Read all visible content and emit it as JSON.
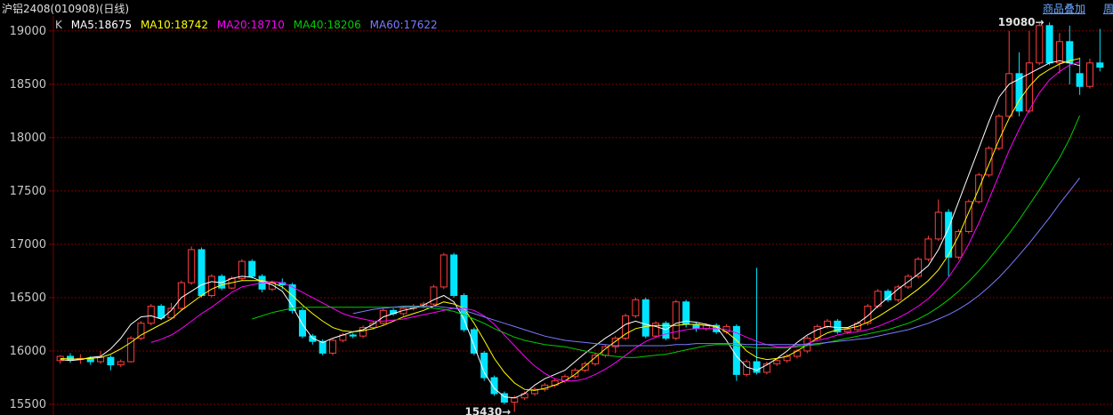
{
  "header": {
    "title": "沪铝2408(010908)(日线)",
    "overlay_link": "商品叠加",
    "period_link": "周"
  },
  "legend": {
    "k_label": "K",
    "ma5": "MA5:18675",
    "ma10": "MA10:18742",
    "ma20": "MA20:18710",
    "ma40": "MA40:18206",
    "ma60": "MA60:17622"
  },
  "colors": {
    "background": "#000000",
    "up": "#ff3d3d",
    "down": "#00e5ff",
    "grid": "#7a0000",
    "axis_text": "#c8c8c8",
    "ma5": "#ffffff",
    "ma10": "#ffff00",
    "ma20": "#ff00ff",
    "ma40": "#00cc00",
    "ma60": "#7a7aff"
  },
  "chart_data": {
    "type": "candlestick",
    "ylim": [
      15400,
      19140
    ],
    "yticks": [
      15500,
      16000,
      16500,
      17000,
      17500,
      18000,
      18500,
      19000
    ],
    "grid": true,
    "annotations": {
      "high_label": "19080",
      "high_value": 19080,
      "low_label": "15430",
      "low_value": 15430
    },
    "series": [
      {
        "name": "MA5",
        "values": [
          15920,
          15910,
          15920,
          15940,
          15950,
          16020,
          16120,
          16250,
          16320,
          16330,
          16300,
          16380,
          16500,
          16560,
          16620,
          16650,
          16640,
          16680,
          16700,
          16690,
          16650,
          16620,
          16560,
          16420,
          16250,
          16120,
          16080,
          16120,
          16150,
          16180,
          16200,
          16250,
          16320,
          16350,
          16380,
          16400,
          16430,
          16480,
          16520,
          16460,
          16300,
          16050,
          15800,
          15650,
          15570,
          15560,
          15600,
          15680,
          15740,
          15780,
          15820,
          15900,
          15980,
          16050,
          16120,
          16180,
          16250,
          16280,
          16250,
          16230,
          16200,
          16260,
          16280,
          16270,
          16250,
          16230,
          16100,
          15950,
          15850,
          15820,
          15870,
          15930,
          16000,
          16080,
          16150,
          16200,
          16230,
          16220,
          16220,
          16260,
          16330,
          16420,
          16500,
          16580,
          16650,
          16720,
          16800,
          16950,
          17150,
          17400,
          17650,
          17900,
          18150,
          18380,
          18500,
          18550,
          18600,
          18650,
          18700,
          18720,
          18700,
          18675
        ]
      },
      {
        "name": "MA10",
        "values": [
          15930,
          15925,
          15925,
          15930,
          15940,
          15970,
          16020,
          16080,
          16150,
          16200,
          16250,
          16300,
          16380,
          16450,
          16520,
          16580,
          16620,
          16640,
          16660,
          16660,
          16660,
          16640,
          16600,
          16520,
          16430,
          16350,
          16280,
          16220,
          16190,
          16180,
          16190,
          16210,
          16240,
          16280,
          16320,
          16350,
          16380,
          16420,
          16460,
          16440,
          16400,
          16260,
          16100,
          15930,
          15800,
          15700,
          15640,
          15630,
          15650,
          15680,
          15720,
          15780,
          15860,
          15940,
          16020,
          16090,
          16160,
          16210,
          16230,
          16240,
          16240,
          16240,
          16250,
          16250,
          16240,
          16230,
          16180,
          16100,
          16000,
          15940,
          15920,
          15930,
          15950,
          16000,
          16060,
          16120,
          16170,
          16200,
          16210,
          16230,
          16270,
          16320,
          16380,
          16440,
          16510,
          16580,
          16660,
          16760,
          16900,
          17080,
          17300,
          17520,
          17750,
          17980,
          18180,
          18350,
          18480,
          18580,
          18640,
          18690,
          18720,
          18742
        ]
      },
      {
        "name": "MA20",
        "values": [
          null,
          null,
          null,
          null,
          null,
          null,
          null,
          null,
          null,
          16080,
          16110,
          16150,
          16210,
          16280,
          16350,
          16410,
          16480,
          16550,
          16600,
          16620,
          16640,
          16650,
          16640,
          16600,
          16550,
          16500,
          16450,
          16400,
          16350,
          16320,
          16300,
          16280,
          16280,
          16290,
          16300,
          16320,
          16340,
          16360,
          16380,
          16400,
          16400,
          16380,
          16330,
          16250,
          16150,
          16050,
          15950,
          15860,
          15790,
          15740,
          15720,
          15720,
          15740,
          15780,
          15830,
          15890,
          15960,
          16030,
          16090,
          16130,
          16160,
          16180,
          16200,
          16210,
          16210,
          16210,
          16200,
          16170,
          16130,
          16090,
          16060,
          16040,
          16040,
          16050,
          16070,
          16100,
          16120,
          16150,
          16170,
          16180,
          16200,
          16230,
          16270,
          16310,
          16360,
          16420,
          16490,
          16580,
          16690,
          16830,
          17000,
          17200,
          17420,
          17650,
          17880,
          18080,
          18260,
          18420,
          18540,
          18620,
          18680,
          18710
        ]
      },
      {
        "name": "MA40",
        "values": [
          null,
          null,
          null,
          null,
          null,
          null,
          null,
          null,
          null,
          null,
          null,
          null,
          null,
          null,
          null,
          null,
          null,
          null,
          null,
          16300,
          16330,
          16360,
          16380,
          16400,
          16410,
          16410,
          16410,
          16410,
          16410,
          16410,
          16410,
          16410,
          16410,
          16410,
          16410,
          16410,
          16410,
          16400,
          16390,
          16370,
          16340,
          16300,
          16260,
          16210,
          16170,
          16130,
          16100,
          16080,
          16060,
          16050,
          16040,
          16020,
          16000,
          15980,
          15960,
          15950,
          15940,
          15940,
          15950,
          15960,
          15970,
          15990,
          16010,
          16030,
          16050,
          16060,
          16060,
          16050,
          16040,
          16030,
          16030,
          16030,
          16030,
          16040,
          16050,
          16060,
          16080,
          16100,
          16120,
          16140,
          16160,
          16180,
          16200,
          16230,
          16260,
          16300,
          16350,
          16410,
          16480,
          16560,
          16650,
          16750,
          16860,
          16980,
          17100,
          17230,
          17370,
          17510,
          17660,
          17810,
          17990,
          18206
        ]
      },
      {
        "name": "MA60",
        "values": [
          null,
          null,
          null,
          null,
          null,
          null,
          null,
          null,
          null,
          null,
          null,
          null,
          null,
          null,
          null,
          null,
          null,
          null,
          null,
          null,
          null,
          null,
          null,
          null,
          null,
          null,
          null,
          null,
          null,
          16350,
          16370,
          16390,
          16400,
          16410,
          16420,
          16420,
          16420,
          16420,
          16410,
          16400,
          16380,
          16350,
          16320,
          16290,
          16260,
          16230,
          16200,
          16170,
          16140,
          16120,
          16100,
          16090,
          16080,
          16070,
          16060,
          16050,
          16050,
          16050,
          16050,
          16050,
          16050,
          16060,
          16060,
          16070,
          16070,
          16070,
          16070,
          16070,
          16060,
          16060,
          16060,
          16060,
          16060,
          16060,
          16060,
          16070,
          16080,
          16090,
          16100,
          16110,
          16120,
          16140,
          16160,
          16180,
          16200,
          16230,
          16260,
          16300,
          16340,
          16390,
          16450,
          16520,
          16600,
          16690,
          16790,
          16900,
          17010,
          17130,
          17250,
          17380,
          17500,
          17622
        ]
      }
    ],
    "candles": [
      [
        15910,
        15950,
        15880,
        15960
      ],
      [
        15950,
        15920,
        15890,
        15980
      ],
      [
        15920,
        15930,
        15880,
        15970
      ],
      [
        15930,
        15900,
        15870,
        15950
      ],
      [
        15900,
        15940,
        15880,
        16000
      ],
      [
        15940,
        15870,
        15820,
        15960
      ],
      [
        15870,
        15900,
        15850,
        15920
      ],
      [
        15900,
        16120,
        15890,
        16140
      ],
      [
        16120,
        16260,
        16100,
        16280
      ],
      [
        16260,
        16420,
        16240,
        16440
      ],
      [
        16420,
        16310,
        16290,
        16440
      ],
      [
        16310,
        16400,
        16300,
        16450
      ],
      [
        16400,
        16640,
        16380,
        16660
      ],
      [
        16640,
        16950,
        16620,
        16980
      ],
      [
        16950,
        16520,
        16500,
        16970
      ],
      [
        16520,
        16700,
        16500,
        16720
      ],
      [
        16700,
        16590,
        16570,
        16720
      ],
      [
        16590,
        16680,
        16580,
        16700
      ],
      [
        16680,
        16840,
        16660,
        16860
      ],
      [
        16840,
        16700,
        16680,
        16860
      ],
      [
        16700,
        16580,
        16550,
        16720
      ],
      [
        16580,
        16640,
        16560,
        16660
      ],
      [
        16640,
        16620,
        16580,
        16680
      ],
      [
        16620,
        16380,
        16350,
        16640
      ],
      [
        16380,
        16140,
        16120,
        16400
      ],
      [
        16140,
        16090,
        16060,
        16160
      ],
      [
        16090,
        15980,
        15960,
        16110
      ],
      [
        15980,
        16100,
        15960,
        16120
      ],
      [
        16100,
        16150,
        16080,
        16170
      ],
      [
        16150,
        16140,
        16120,
        16170
      ],
      [
        16140,
        16220,
        16120,
        16240
      ],
      [
        16220,
        16260,
        16200,
        16280
      ],
      [
        16260,
        16380,
        16240,
        16400
      ],
      [
        16380,
        16350,
        16330,
        16400
      ],
      [
        16350,
        16400,
        16330,
        16420
      ],
      [
        16400,
        16420,
        16380,
        16440
      ],
      [
        16420,
        16440,
        16400,
        16460
      ],
      [
        16440,
        16600,
        16420,
        16620
      ],
      [
        16600,
        16900,
        16580,
        16920
      ],
      [
        16900,
        16520,
        16500,
        16920
      ],
      [
        16520,
        16200,
        16180,
        16540
      ],
      [
        16200,
        15980,
        15960,
        16220
      ],
      [
        15980,
        15750,
        15720,
        16000
      ],
      [
        15750,
        15600,
        15580,
        15770
      ],
      [
        15600,
        15520,
        15500,
        15620
      ],
      [
        15520,
        15560,
        15430,
        15580
      ],
      [
        15560,
        15600,
        15540,
        15620
      ],
      [
        15600,
        15640,
        15580,
        15660
      ],
      [
        15640,
        15680,
        15620,
        15700
      ],
      [
        15680,
        15720,
        15660,
        15740
      ],
      [
        15720,
        15760,
        15700,
        15780
      ],
      [
        15760,
        15820,
        15740,
        15840
      ],
      [
        15820,
        15880,
        15800,
        15900
      ],
      [
        15880,
        15960,
        15860,
        15980
      ],
      [
        15960,
        16040,
        15940,
        16060
      ],
      [
        16040,
        16120,
        15980,
        16140
      ],
      [
        16120,
        16330,
        16100,
        16350
      ],
      [
        16330,
        16480,
        16310,
        16500
      ],
      [
        16480,
        16140,
        16120,
        16500
      ],
      [
        16140,
        16260,
        16120,
        16280
      ],
      [
        16260,
        16120,
        16100,
        16280
      ],
      [
        16120,
        16460,
        16100,
        16480
      ],
      [
        16460,
        16250,
        16220,
        16480
      ],
      [
        16250,
        16210,
        16180,
        16270
      ],
      [
        16210,
        16240,
        16190,
        16260
      ],
      [
        16240,
        16180,
        16160,
        16260
      ],
      [
        16180,
        16230,
        16160,
        16250
      ],
      [
        16230,
        15780,
        15720,
        16250
      ],
      [
        15780,
        15900,
        15760,
        15920
      ],
      [
        15900,
        15800,
        15780,
        16780
      ],
      [
        15800,
        15880,
        15780,
        15900
      ],
      [
        15880,
        15910,
        15860,
        15930
      ],
      [
        15910,
        15950,
        15890,
        15970
      ],
      [
        15950,
        16000,
        15930,
        16020
      ],
      [
        16000,
        16120,
        15980,
        16140
      ],
      [
        16120,
        16230,
        16100,
        16250
      ],
      [
        16230,
        16280,
        16210,
        16300
      ],
      [
        16280,
        16180,
        16160,
        16300
      ],
      [
        16180,
        16200,
        16160,
        16220
      ],
      [
        16200,
        16260,
        16180,
        16280
      ],
      [
        16260,
        16420,
        16240,
        16440
      ],
      [
        16420,
        16560,
        16400,
        16580
      ],
      [
        16560,
        16480,
        16460,
        16580
      ],
      [
        16480,
        16600,
        16460,
        16620
      ],
      [
        16600,
        16700,
        16580,
        16720
      ],
      [
        16700,
        16860,
        16680,
        16880
      ],
      [
        16860,
        17050,
        16840,
        17080
      ],
      [
        17050,
        17300,
        17030,
        17420
      ],
      [
        17300,
        16880,
        16700,
        17330
      ],
      [
        16880,
        17120,
        16860,
        17140
      ],
      [
        17120,
        17400,
        17100,
        17420
      ],
      [
        17400,
        17650,
        17380,
        17670
      ],
      [
        17650,
        17900,
        17630,
        17920
      ],
      [
        17900,
        18200,
        17880,
        18220
      ],
      [
        18200,
        18600,
        18180,
        19000
      ],
      [
        18600,
        18250,
        18200,
        18800
      ],
      [
        18250,
        18700,
        18230,
        19000
      ],
      [
        18700,
        19050,
        18680,
        19080
      ],
      [
        19050,
        18700,
        18680,
        19080
      ],
      [
        18700,
        18900,
        18600,
        18980
      ],
      [
        18900,
        18700,
        18500,
        19050
      ],
      [
        18600,
        18480,
        18400,
        18750
      ],
      [
        18480,
        18700,
        18460,
        18740
      ],
      [
        18700,
        18660,
        18620,
        19020
      ]
    ]
  }
}
